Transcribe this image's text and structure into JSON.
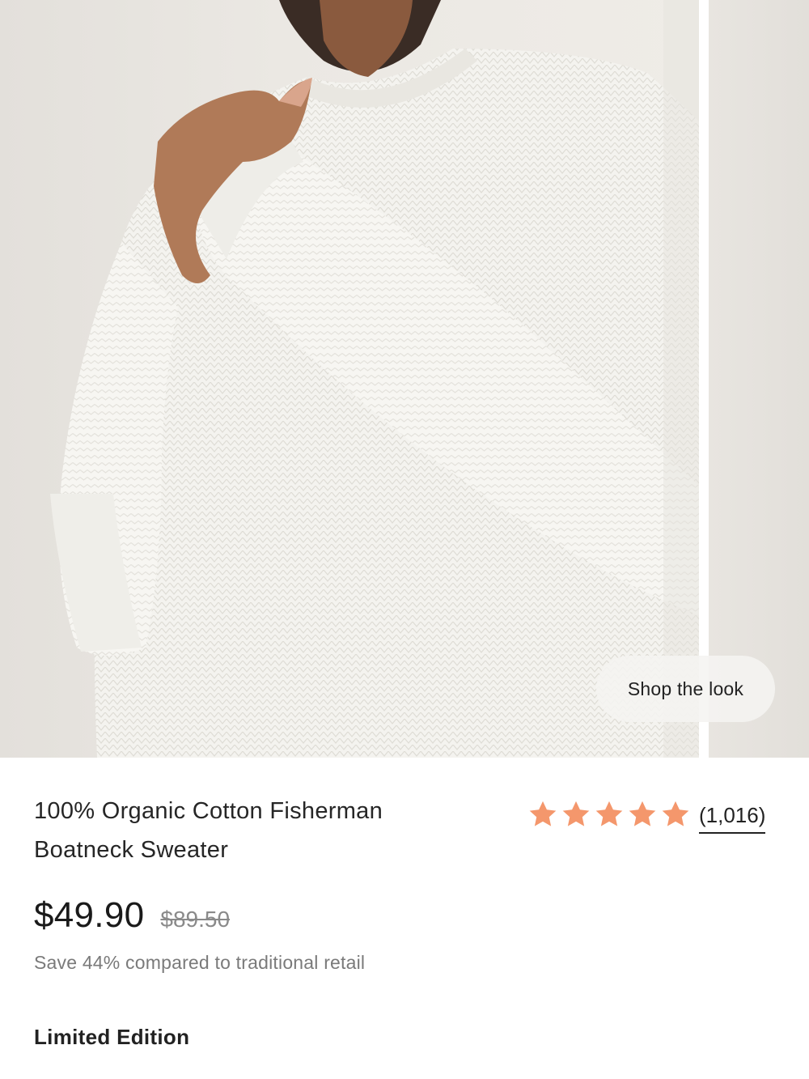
{
  "gallery": {
    "shop_look_label": "Shop the look"
  },
  "product": {
    "title": "100% Organic Cotton Fisherman Boatneck Sweater",
    "rating": 5,
    "rating_max": 5,
    "review_count": "(1,016)",
    "price": "$49.90",
    "original_price": "$89.50",
    "savings_text": "Save 44% compared to traditional retail",
    "edition_label": "Limited Edition"
  },
  "colors": {
    "star": "#f4976c",
    "sweater": "#f7f6f2",
    "background": "#ebe8e3"
  },
  "icons": {
    "star": "star-icon"
  }
}
